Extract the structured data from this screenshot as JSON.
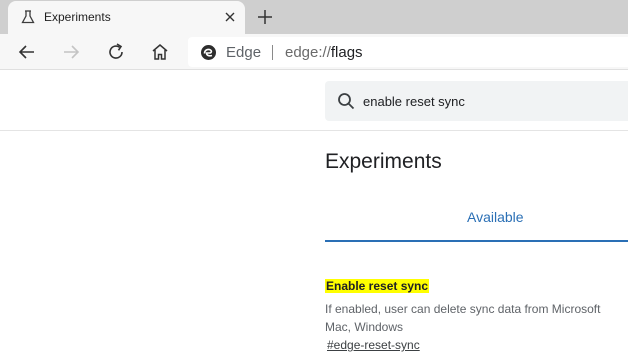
{
  "browser": {
    "tab": {
      "title": "Experiments"
    },
    "omnibox": {
      "site_label": "Edge",
      "url_prefix": "edge://",
      "url_path": "flags"
    }
  },
  "page": {
    "search": {
      "value": "enable reset sync"
    },
    "title": "Experiments",
    "tabs": [
      {
        "label": "Available",
        "active": true
      }
    ],
    "experiment": {
      "name": "Enable reset sync",
      "description_line1": "If enabled, user can delete sync data from Microsoft",
      "description_line2": "Mac, Windows",
      "anchor": "#edge-reset-sync"
    }
  },
  "colors": {
    "accent": "#2a6fb5",
    "highlight": "#ffff00",
    "tabstrip": "#cfcfcf"
  }
}
